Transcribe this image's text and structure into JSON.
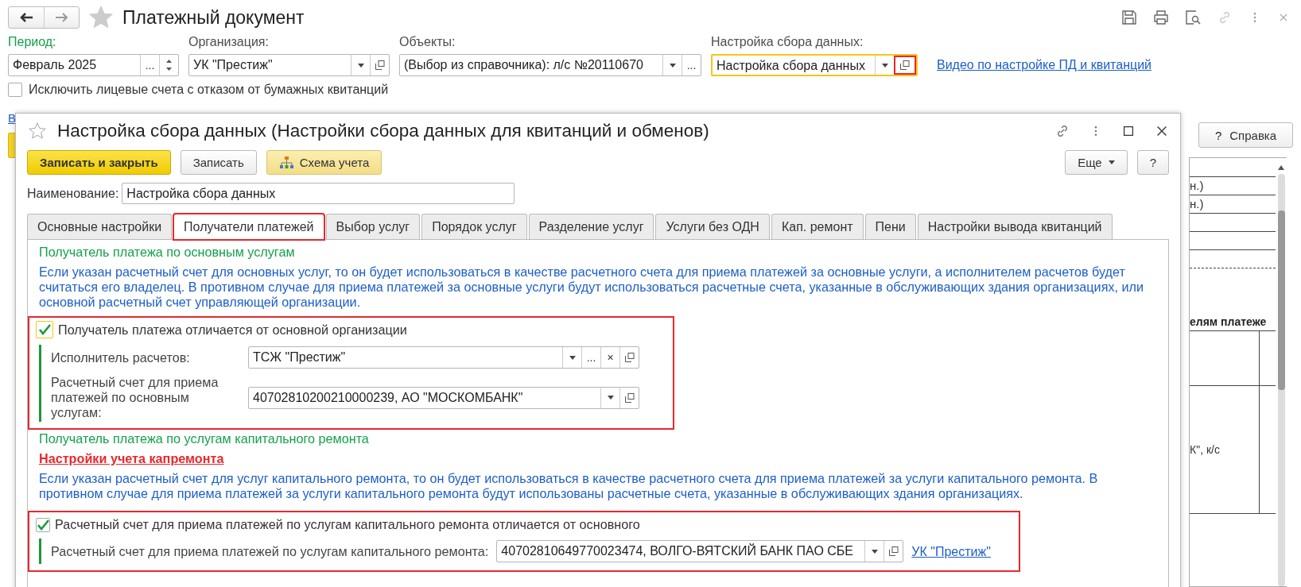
{
  "page": {
    "title": "Платежный документ",
    "filters": [
      {
        "label": "Период:",
        "color": "#14a04a",
        "value": "Февраль 2025",
        "kind": "plain",
        "highlighted": false,
        "buttons": [
          {
            "kind": "text",
            "text": "..."
          },
          {
            "kind": "spin"
          }
        ]
      },
      {
        "label": "Организация:",
        "color": "#4d4d4d",
        "value": "УК \"Престиж\"",
        "kind": "plain",
        "highlighted": false,
        "buttons": [
          {
            "kind": "dropdown"
          },
          {
            "kind": "open"
          }
        ]
      },
      {
        "label": "Объекты:",
        "color": "#4d4d4d",
        "value": "(Выбор из справочника): л/с №20110670",
        "kind": "plain",
        "highlighted": false,
        "buttons": [
          {
            "kind": "dropdown"
          },
          {
            "kind": "text",
            "text": "..."
          }
        ]
      },
      {
        "label": "Настройка сбора данных:",
        "color": "#4d4d4d",
        "value": "Настройка сбора данных",
        "kind": "focused",
        "highlighted": true,
        "buttons": [
          {
            "kind": "dropdown"
          },
          {
            "kind": "open"
          }
        ]
      }
    ],
    "video_link": "Видео по настройке ПД и квитанций",
    "exclude": {
      "label": "Исключить лицевые счета с отказом от бумажных квитанций",
      "checked": false
    },
    "stub_link": "В",
    "help_button": {
      "icon": "?",
      "label": "Справка"
    },
    "report": {
      "rows": [
        "н.)",
        "н.)"
      ],
      "heading": "елям платеже",
      "cell": "К\", к/с"
    }
  },
  "dialog": {
    "title": "Настройка сбора данных (Настройки сбора данных для квитанций и обменов)",
    "buttons": [
      {
        "label": "Записать и закрыть",
        "kind": "primary"
      },
      {
        "label": "Записать",
        "kind": "normal"
      },
      {
        "label": "Схема учета",
        "kind": "scheme"
      }
    ],
    "more_button": "Еще",
    "help_button": "?",
    "name": {
      "label": "Наименование:",
      "value": "Настройка сбора данных"
    },
    "tabs": [
      {
        "label": "Основные настройки",
        "selected": false,
        "highlighted": false
      },
      {
        "label": "Получатели платежей",
        "selected": true,
        "highlighted": true
      },
      {
        "label": "Выбор услуг",
        "selected": false,
        "highlighted": false
      },
      {
        "label": "Порядок услуг",
        "selected": false,
        "highlighted": false
      },
      {
        "label": "Разделение услуг",
        "selected": false,
        "highlighted": false
      },
      {
        "label": "Услуги без ОДН",
        "selected": false,
        "highlighted": false
      },
      {
        "label": "Кап. ремонт",
        "selected": false,
        "highlighted": false
      },
      {
        "label": "Пени",
        "selected": false,
        "highlighted": false
      },
      {
        "label": "Настройки вывода квитанций",
        "selected": false,
        "highlighted": false
      }
    ],
    "sections": [
      {
        "heading": "Получатель платежа по основным услугам",
        "note": "Если указан расчетный счет для основных услуг, то он будет использоваться в качестве расчетного счета для приема платежей за основные услуги, а исполнителем расчетов будет считаться его владелец. В противном случае для приема платежей за основные услуги будут использоваться расчетные счета, указанные в обслуживающих здания организациях, или основной расчетный счет управляющей организации.",
        "group": {
          "highlighted": true,
          "checkbox": {
            "label": "Получатель платежа отличается от основной организации",
            "checked": true,
            "focused": true
          },
          "fields": [
            {
              "label": "Исполнитель расчетов:",
              "value": "ТСЖ \"Престиж\"",
              "buttons": [
                {
                  "kind": "dropdown"
                },
                {
                  "kind": "text",
                  "text": "..."
                },
                {
                  "kind": "text",
                  "text": "×"
                },
                {
                  "kind": "open"
                }
              ]
            },
            {
              "label": "Расчетный счет для приема платежей по основным услугам:",
              "value": "40702810200210000239, АО \"МОСКОМБАНК\"",
              "buttons": [
                {
                  "kind": "dropdown"
                },
                {
                  "kind": "open"
                }
              ]
            }
          ]
        }
      },
      {
        "heading": "Получатель платежа по услугам капитального ремонта",
        "link": "Настройки учета капремонта",
        "note": "Если указан расчетный счет для услуг капитального ремонта, то он будет использоваться в качестве расчетного счета для приема платежей за услуги капитального ремонта. В противном случае для приема платежей за услуги капитального ремонта будут использованы расчетные счета, указанные в обслуживающих здания организациях.",
        "group": {
          "highlighted": true,
          "checkbox": {
            "label": "Расчетный счет для приема платежей по услугам капитального ремонта отличается от основного",
            "checked": true,
            "focused": false
          },
          "fields": [
            {
              "label": "Расчетный счет для приема платежей по услугам капитального ремонта:",
              "value": "40702810649770023474, ВОЛГО-ВЯТСКИЙ БАНК ПАО СБЕ",
              "buttons": [
                {
                  "kind": "dropdown"
                },
                {
                  "kind": "open"
                }
              ],
              "link": "УК \"Престиж\""
            }
          ]
        }
      }
    ]
  }
}
